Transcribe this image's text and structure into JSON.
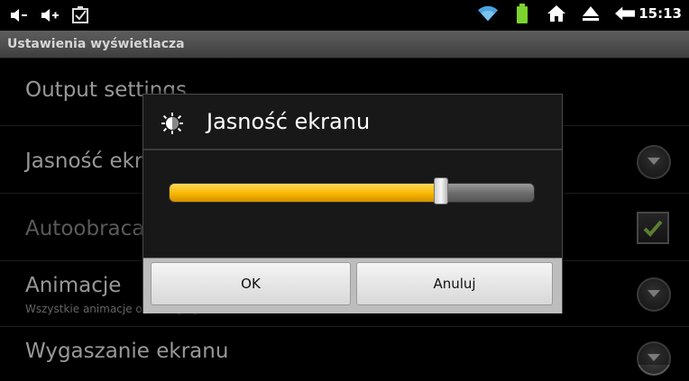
{
  "status_bar": {
    "time": "15:13",
    "icons": [
      "volume-down-icon",
      "volume-up-icon",
      "screenshot-icon",
      "wifi-icon",
      "battery-icon",
      "home-icon",
      "eject-icon",
      "back-icon"
    ]
  },
  "title_bar": {
    "title": "Ustawienia wyświetlacza"
  },
  "settings": [
    {
      "title": "Output settings",
      "subtitle": "",
      "control": "none"
    },
    {
      "title": "Jasność ekranu",
      "subtitle": "",
      "control": "chevron"
    },
    {
      "title": "Autoobracanie ekranu",
      "subtitle": "",
      "control": "checkbox",
      "checked": true
    },
    {
      "title": "Animacje",
      "subtitle": "Wszystkie animacje okien są wyświetlane",
      "control": "chevron"
    },
    {
      "title": "Wygaszanie ekranu",
      "subtitle": "",
      "control": "chevron"
    }
  ],
  "dialog": {
    "icon": "brightness-icon",
    "title": "Jasność ekranu",
    "brightness_fraction": 0.745,
    "ok_label": "OK",
    "cancel_label": "Anuluj"
  },
  "colors": {
    "slider_fill": "#f7b700",
    "checkbox_check": "#8bc34a"
  }
}
